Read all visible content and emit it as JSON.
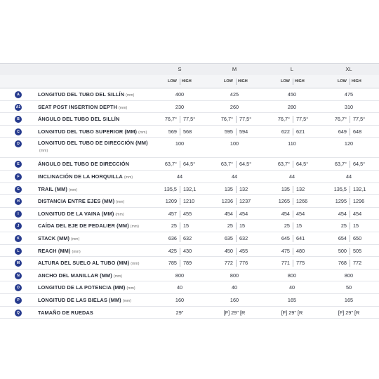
{
  "sizes": [
    "S",
    "M",
    "L",
    "XL"
  ],
  "low_label": "LOW",
  "high_label": "HIGH",
  "rows": [
    {
      "badge": "A",
      "label": "LONGITUD DEL TUBO DEL SILLÍN",
      "unit": "(mm)",
      "type": "single",
      "values": [
        "400",
        "425",
        "450",
        "475"
      ]
    },
    {
      "badge": "A1",
      "label": "SEAT POST INSERTION DEPTH",
      "unit": "(mm)",
      "type": "single",
      "values": [
        "230",
        "260",
        "280",
        "310"
      ]
    },
    {
      "badge": "B",
      "label": "ÁNGULO DEL TUBO DEL SILLÍN",
      "unit": "",
      "type": "pair",
      "values": [
        [
          "76,7°",
          "77,5°"
        ],
        [
          "76,7°",
          "77,5°"
        ],
        [
          "76,7°",
          "77,5°"
        ],
        [
          "76,7°",
          "77,5°"
        ]
      ]
    },
    {
      "badge": "C",
      "label": "LONGITUD DEL TUBO SUPERIOR (MM)",
      "unit": "(mm)",
      "type": "pair",
      "values": [
        [
          "569",
          "568"
        ],
        [
          "595",
          "594"
        ],
        [
          "622",
          "621"
        ],
        [
          "649",
          "648"
        ]
      ]
    },
    {
      "badge": "D",
      "label": "LONGITUD DEL TUBO DE DIRECCIÓN (MM)",
      "unit": "(mm)",
      "type": "single",
      "tall": true,
      "values": [
        "100",
        "100",
        "110",
        "120"
      ]
    },
    {
      "badge": "E",
      "label": "ÁNGULO DEL TUBO DE DIRECCIÓN",
      "unit": "",
      "type": "pair",
      "values": [
        [
          "63,7°",
          "64,5°"
        ],
        [
          "63,7°",
          "64,5°"
        ],
        [
          "63,7°",
          "64,5°"
        ],
        [
          "63,7°",
          "64,5°"
        ]
      ]
    },
    {
      "badge": "F",
      "label": "INCLINACIÓN DE LA HORQUILLA",
      "unit": "(mm)",
      "type": "single",
      "values": [
        "44",
        "44",
        "44",
        "44"
      ]
    },
    {
      "badge": "G",
      "label": "TRAIL (MM)",
      "unit": "(mm)",
      "type": "pair",
      "values": [
        [
          "135,5",
          "132,1"
        ],
        [
          "135",
          "132"
        ],
        [
          "135",
          "132"
        ],
        [
          "135,5",
          "132,1"
        ]
      ]
    },
    {
      "badge": "H",
      "label": "DISTANCIA ENTRE EJES (MM)",
      "unit": "(mm)",
      "type": "pair",
      "values": [
        [
          "1209",
          "1210"
        ],
        [
          "1236",
          "1237"
        ],
        [
          "1265",
          "1266"
        ],
        [
          "1295",
          "1296"
        ]
      ]
    },
    {
      "badge": "I",
      "label": "LONGITUD DE LA VAINA (MM)",
      "unit": "(mm)",
      "type": "pair",
      "values": [
        [
          "457",
          "455"
        ],
        [
          "454",
          "454"
        ],
        [
          "454",
          "454"
        ],
        [
          "454",
          "454"
        ]
      ]
    },
    {
      "badge": "J",
      "label": "CAÍDA DEL EJE DE PEDALIER (MM)",
      "unit": "(mm)",
      "type": "pair",
      "values": [
        [
          "25",
          "15"
        ],
        [
          "25",
          "15"
        ],
        [
          "25",
          "15"
        ],
        [
          "25",
          "15"
        ]
      ]
    },
    {
      "badge": "K",
      "label": "STACK (MM)",
      "unit": "(mm)",
      "type": "pair",
      "values": [
        [
          "636",
          "632"
        ],
        [
          "635",
          "632"
        ],
        [
          "645",
          "641"
        ],
        [
          "654",
          "650"
        ]
      ]
    },
    {
      "badge": "L",
      "label": "REACH (MM)",
      "unit": "(mm)",
      "type": "pair",
      "values": [
        [
          "425",
          "430"
        ],
        [
          "450",
          "455"
        ],
        [
          "475",
          "480"
        ],
        [
          "500",
          "505"
        ]
      ]
    },
    {
      "badge": "M",
      "label": "ALTURA DEL SUELO AL TUBO (MM)",
      "unit": "(mm)",
      "type": "pair",
      "values": [
        [
          "785",
          "789"
        ],
        [
          "772",
          "776"
        ],
        [
          "771",
          "775"
        ],
        [
          "768",
          "772"
        ]
      ]
    },
    {
      "badge": "N",
      "label": "ANCHO DEL MANILLAR (MM)",
      "unit": "(mm)",
      "type": "single",
      "values": [
        "800",
        "800",
        "800",
        "800"
      ]
    },
    {
      "badge": "O",
      "label": "LONGITUD DE LA POTENCIA (MM)",
      "unit": "(mm)",
      "type": "single",
      "values": [
        "40",
        "40",
        "40",
        "50"
      ]
    },
    {
      "badge": "P",
      "label": "LONGITUD DE LAS BIELAS (MM)",
      "unit": "(mm)",
      "type": "single",
      "values": [
        "160",
        "160",
        "165",
        "165"
      ]
    },
    {
      "badge": "Q",
      "label": "TAMAÑO DE RUEDAS",
      "unit": "",
      "type": "single",
      "values": [
        "29\"",
        "[F] 29\" [R",
        "[F] 29\" [R",
        "[F] 29\" [R"
      ]
    }
  ]
}
